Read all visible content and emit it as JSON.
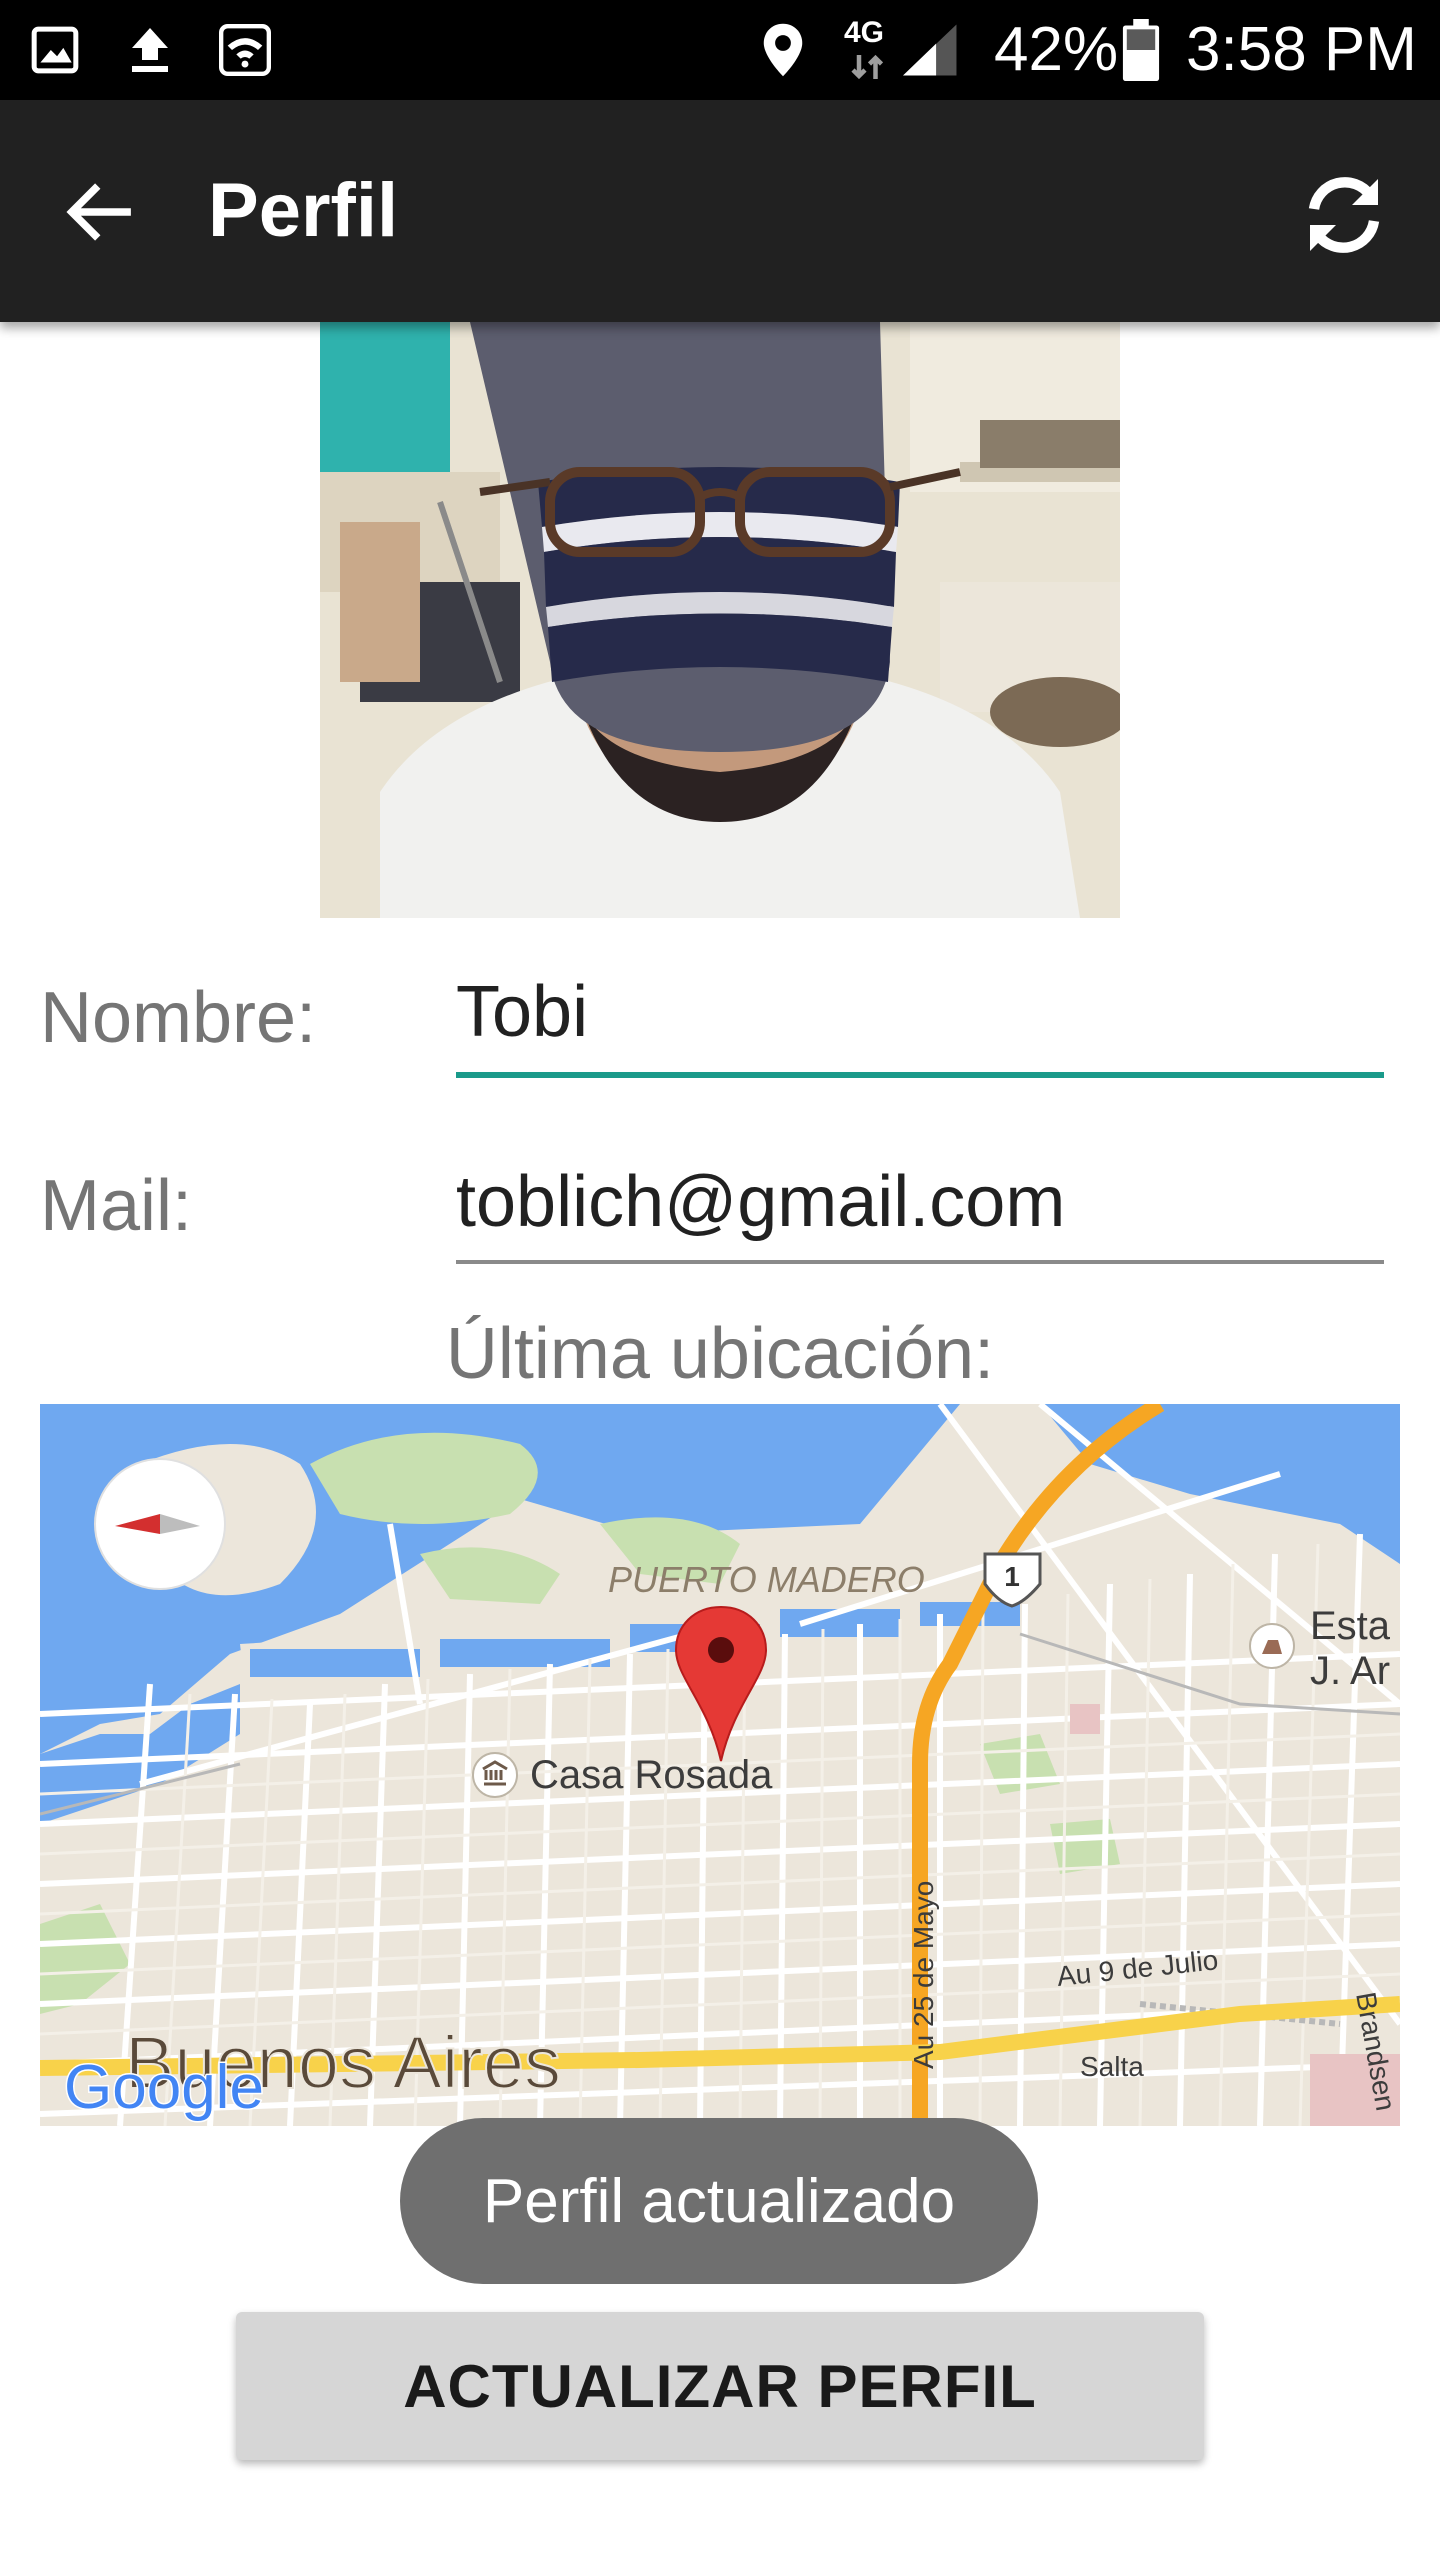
{
  "status_bar": {
    "battery": "42%",
    "time": "3:58 PM",
    "network": "4G",
    "icons": [
      "gallery-icon",
      "upload-icon",
      "wifi-icon",
      "location-icon",
      "network-4g-icon",
      "signal-icon",
      "battery-icon"
    ]
  },
  "app_bar": {
    "title": "Perfil",
    "back_icon": "arrow-back-icon",
    "refresh_icon": "refresh-icon"
  },
  "profile": {
    "name_label": "Nombre:",
    "name_value": "Tobi",
    "mail_label": "Mail:",
    "mail_value": "toblich@gmail.com",
    "location_label": "Última ubicación:"
  },
  "map": {
    "labels": {
      "puerto_madero": "PUERTO MADERO",
      "casa_rosada": "Casa Rosada",
      "buenos_aires": "Buenos Aires",
      "route_1": "1",
      "estacion_line1": "Esta",
      "estacion_line2": "J. Ar",
      "au_25_de_mayo": "Au 25 de Mayo",
      "au_9_de_julio": "Au 9 de Julio",
      "salta": "Salta",
      "brandsen": "Brandsen",
      "google": "Google"
    },
    "colors": {
      "water": "#6fa8f0",
      "land": "#ece6db",
      "park": "#c8e0b0",
      "highway_orange": "#f6a623",
      "highway_yellow": "#f8d24a",
      "marker": "#e53935"
    }
  },
  "toast": {
    "text": "Perfil actualizado"
  },
  "actions": {
    "update_label": "ACTUALIZAR PERFIL"
  },
  "colors": {
    "appbar": "#212121",
    "statusbar": "#000000",
    "accent": "#1a9a8a",
    "toast_bg": "#6f6f6f",
    "button_bg": "#d6d6d6"
  }
}
